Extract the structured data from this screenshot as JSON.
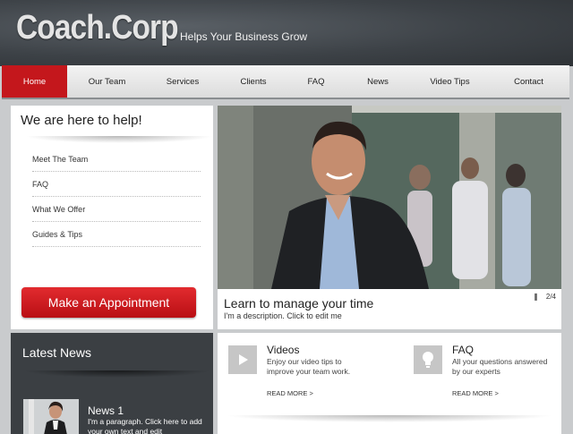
{
  "header": {
    "logo": "Coach.Corp",
    "tagline": "Helps Your Business Grow"
  },
  "nav": {
    "items": [
      {
        "label": "Home",
        "active": true
      },
      {
        "label": "Our Team"
      },
      {
        "label": "Services"
      },
      {
        "label": "Clients"
      },
      {
        "label": "FAQ"
      },
      {
        "label": "News"
      },
      {
        "label": "Video Tips"
      },
      {
        "label": "Contact"
      }
    ]
  },
  "help": {
    "title": "We are here to help!",
    "links": [
      "Meet The Team",
      "FAQ",
      "What We Offer",
      "Guides & Tips"
    ],
    "appointment_button": "Make an Appointment"
  },
  "slideshow": {
    "caption_title": "Learn to manage your time",
    "caption_desc": "I'm a description. Click to edit me",
    "counter": "2/4",
    "pause_icon": "pause-icon"
  },
  "news": {
    "title": "Latest News",
    "item_title": "News 1",
    "item_text": "I'm a paragraph. Click here to add your own text and edit"
  },
  "features": {
    "videos": {
      "icon": "play-icon",
      "title": "Videos",
      "desc": "Enjoy our video tips to improve your team work.",
      "more": "READ MORE >"
    },
    "faq": {
      "icon": "lightbulb-icon",
      "title": "FAQ",
      "desc": "All your questions answered by our experts",
      "more": "READ MORE >"
    }
  },
  "colors": {
    "accent_red": "#c4171c",
    "header_dark": "#3d4247",
    "news_panel": "#3b3f43"
  }
}
